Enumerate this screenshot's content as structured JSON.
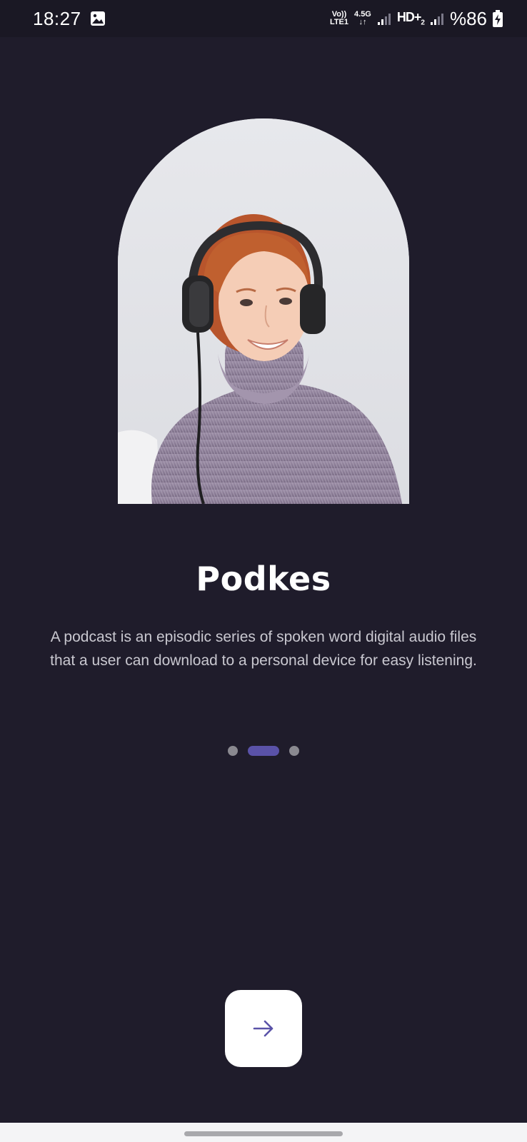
{
  "status_bar": {
    "time": "18:27",
    "volte_label_top": "Vo))",
    "volte_label_bottom": "LTE1",
    "network_label_top": "4.5G",
    "network_label_bottom": "↓↑",
    "hd_label": "HD+",
    "hd_sub": "2",
    "battery_percent": "%86",
    "icons": [
      "gallery-icon",
      "signal-icon",
      "signal-icon",
      "battery-charging-icon"
    ]
  },
  "onboarding": {
    "title": "Podkes",
    "description": "A podcast is an episodic series of spoken word digital audio files that a user can download to a personal device for easy listening.",
    "page_count": 3,
    "active_page": 1
  },
  "next_button": {
    "icon": "arrow-right-icon"
  },
  "colors": {
    "background": "#1f1c2b",
    "accent": "#5a52a8",
    "inactive_dot": "#8a8990",
    "button_bg": "#ffffff",
    "text_secondary": "#c9c8d0"
  }
}
